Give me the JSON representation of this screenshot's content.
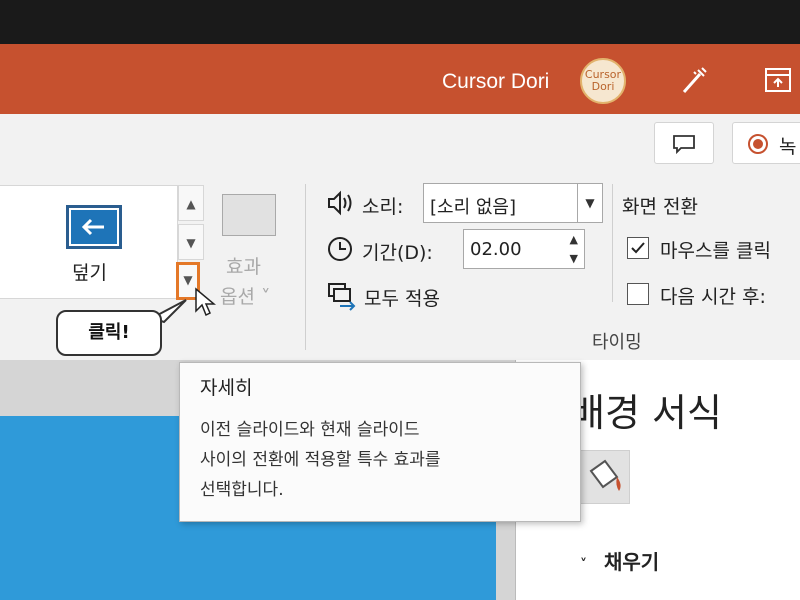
{
  "titlebar": {
    "user_name": "Cursor Dori",
    "avatar_text": "Cursor Dori",
    "accent_color": "#c6512f"
  },
  "toolbar": {
    "record_label": "녹"
  },
  "transitions": {
    "cover_label": "덮기",
    "effect_options_line1": "효과",
    "effect_options_line2": "옵션 ˅",
    "more_icon": "chevron-down-icon"
  },
  "timing": {
    "sound_label": "소리:",
    "sound_value": "[소리 없음]",
    "duration_label": "기간(D):",
    "duration_value": "02.00",
    "apply_all_label": "모두 적용",
    "advance_slide_label": "화면 전환",
    "on_mouse_click_label": "마우스를 클릭",
    "on_mouse_click_checked": true,
    "after_time_label": "다음 시간 후:",
    "after_time_checked": false,
    "group_label": "타이밍"
  },
  "tooltip": {
    "title": "자세히",
    "body": "이전 슬라이드와 현재 슬라이드\n사이의 전환에 적용할 특수 효과를\n선택합니다."
  },
  "callout": {
    "text": "클릭!",
    "highlight_color": "#e47828"
  },
  "format_pane": {
    "title": "배경 서식",
    "fill_section": "채우기"
  },
  "watermark": {
    "text": "Cursor Dori"
  }
}
